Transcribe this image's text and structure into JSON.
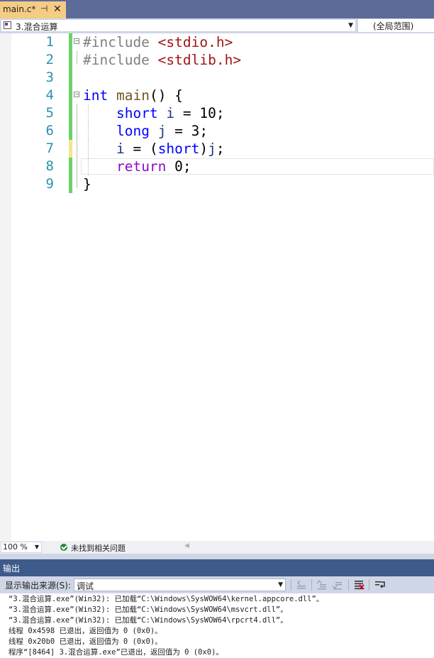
{
  "tab": {
    "title": "main.c*",
    "pin_glyph": "⊣",
    "close_glyph": "✕"
  },
  "navbar": {
    "scope": "3.混合运算",
    "global_scope": "(全局范围)"
  },
  "editor": {
    "line_numbers": [
      "1",
      "2",
      "3",
      "4",
      "5",
      "6",
      "7",
      "8",
      "9"
    ],
    "lines": [
      [
        {
          "t": "#include ",
          "c": "kw-pp"
        },
        {
          "t": "<stdio.h>",
          "c": "kw-inc"
        }
      ],
      [
        {
          "t": "#include ",
          "c": "kw-pp"
        },
        {
          "t": "<stdlib.h>",
          "c": "kw-inc"
        }
      ],
      [],
      [
        {
          "t": "int",
          "c": "kw-type"
        },
        {
          "t": " ",
          "c": "plain"
        },
        {
          "t": "main",
          "c": "kw-fn"
        },
        {
          "t": "() {",
          "c": "plain"
        }
      ],
      [
        {
          "t": "    ",
          "c": "plain"
        },
        {
          "t": "short",
          "c": "kw-type"
        },
        {
          "t": " ",
          "c": "plain"
        },
        {
          "t": "i",
          "c": "kw-var"
        },
        {
          "t": " = 10;",
          "c": "plain"
        }
      ],
      [
        {
          "t": "    ",
          "c": "plain"
        },
        {
          "t": "long",
          "c": "kw-type"
        },
        {
          "t": " ",
          "c": "plain"
        },
        {
          "t": "j",
          "c": "kw-var"
        },
        {
          "t": " = 3;",
          "c": "plain"
        }
      ],
      [
        {
          "t": "    ",
          "c": "plain"
        },
        {
          "t": "i",
          "c": "kw-var"
        },
        {
          "t": " = (",
          "c": "plain"
        },
        {
          "t": "short",
          "c": "kw-type"
        },
        {
          "t": ")",
          "c": "plain"
        },
        {
          "t": "j",
          "c": "kw-var"
        },
        {
          "t": ";",
          "c": "plain"
        }
      ],
      [
        {
          "t": "    ",
          "c": "plain"
        },
        {
          "t": "return",
          "c": "kw-ret"
        },
        {
          "t": " 0;",
          "c": "plain"
        }
      ],
      [
        {
          "t": "}",
          "c": "plain"
        }
      ]
    ]
  },
  "editor_status": {
    "zoom": "100 %",
    "issues": "未找到相关问题"
  },
  "output": {
    "title": "输出",
    "source_label": "显示输出来源(S):",
    "source_value": "调试",
    "lines": [
      "“3.混合运算.exe”(Win32): 已加载“C:\\Windows\\SysWOW64\\kernel.appcore.dll”。",
      "“3.混合运算.exe”(Win32): 已加载“C:\\Windows\\SysWOW64\\msvcrt.dll”。",
      "“3.混合运算.exe”(Win32): 已加载“C:\\Windows\\SysWOW64\\rpcrt4.dll”。",
      "线程 0x4598 已退出，返回值为 0 (0x0)。",
      "线程 0x20b0 已退出，返回值为 0 (0x0)。",
      "程序“[8464] 3.混合运算.exe”已退出，返回值为 0 (0x0)。"
    ]
  }
}
